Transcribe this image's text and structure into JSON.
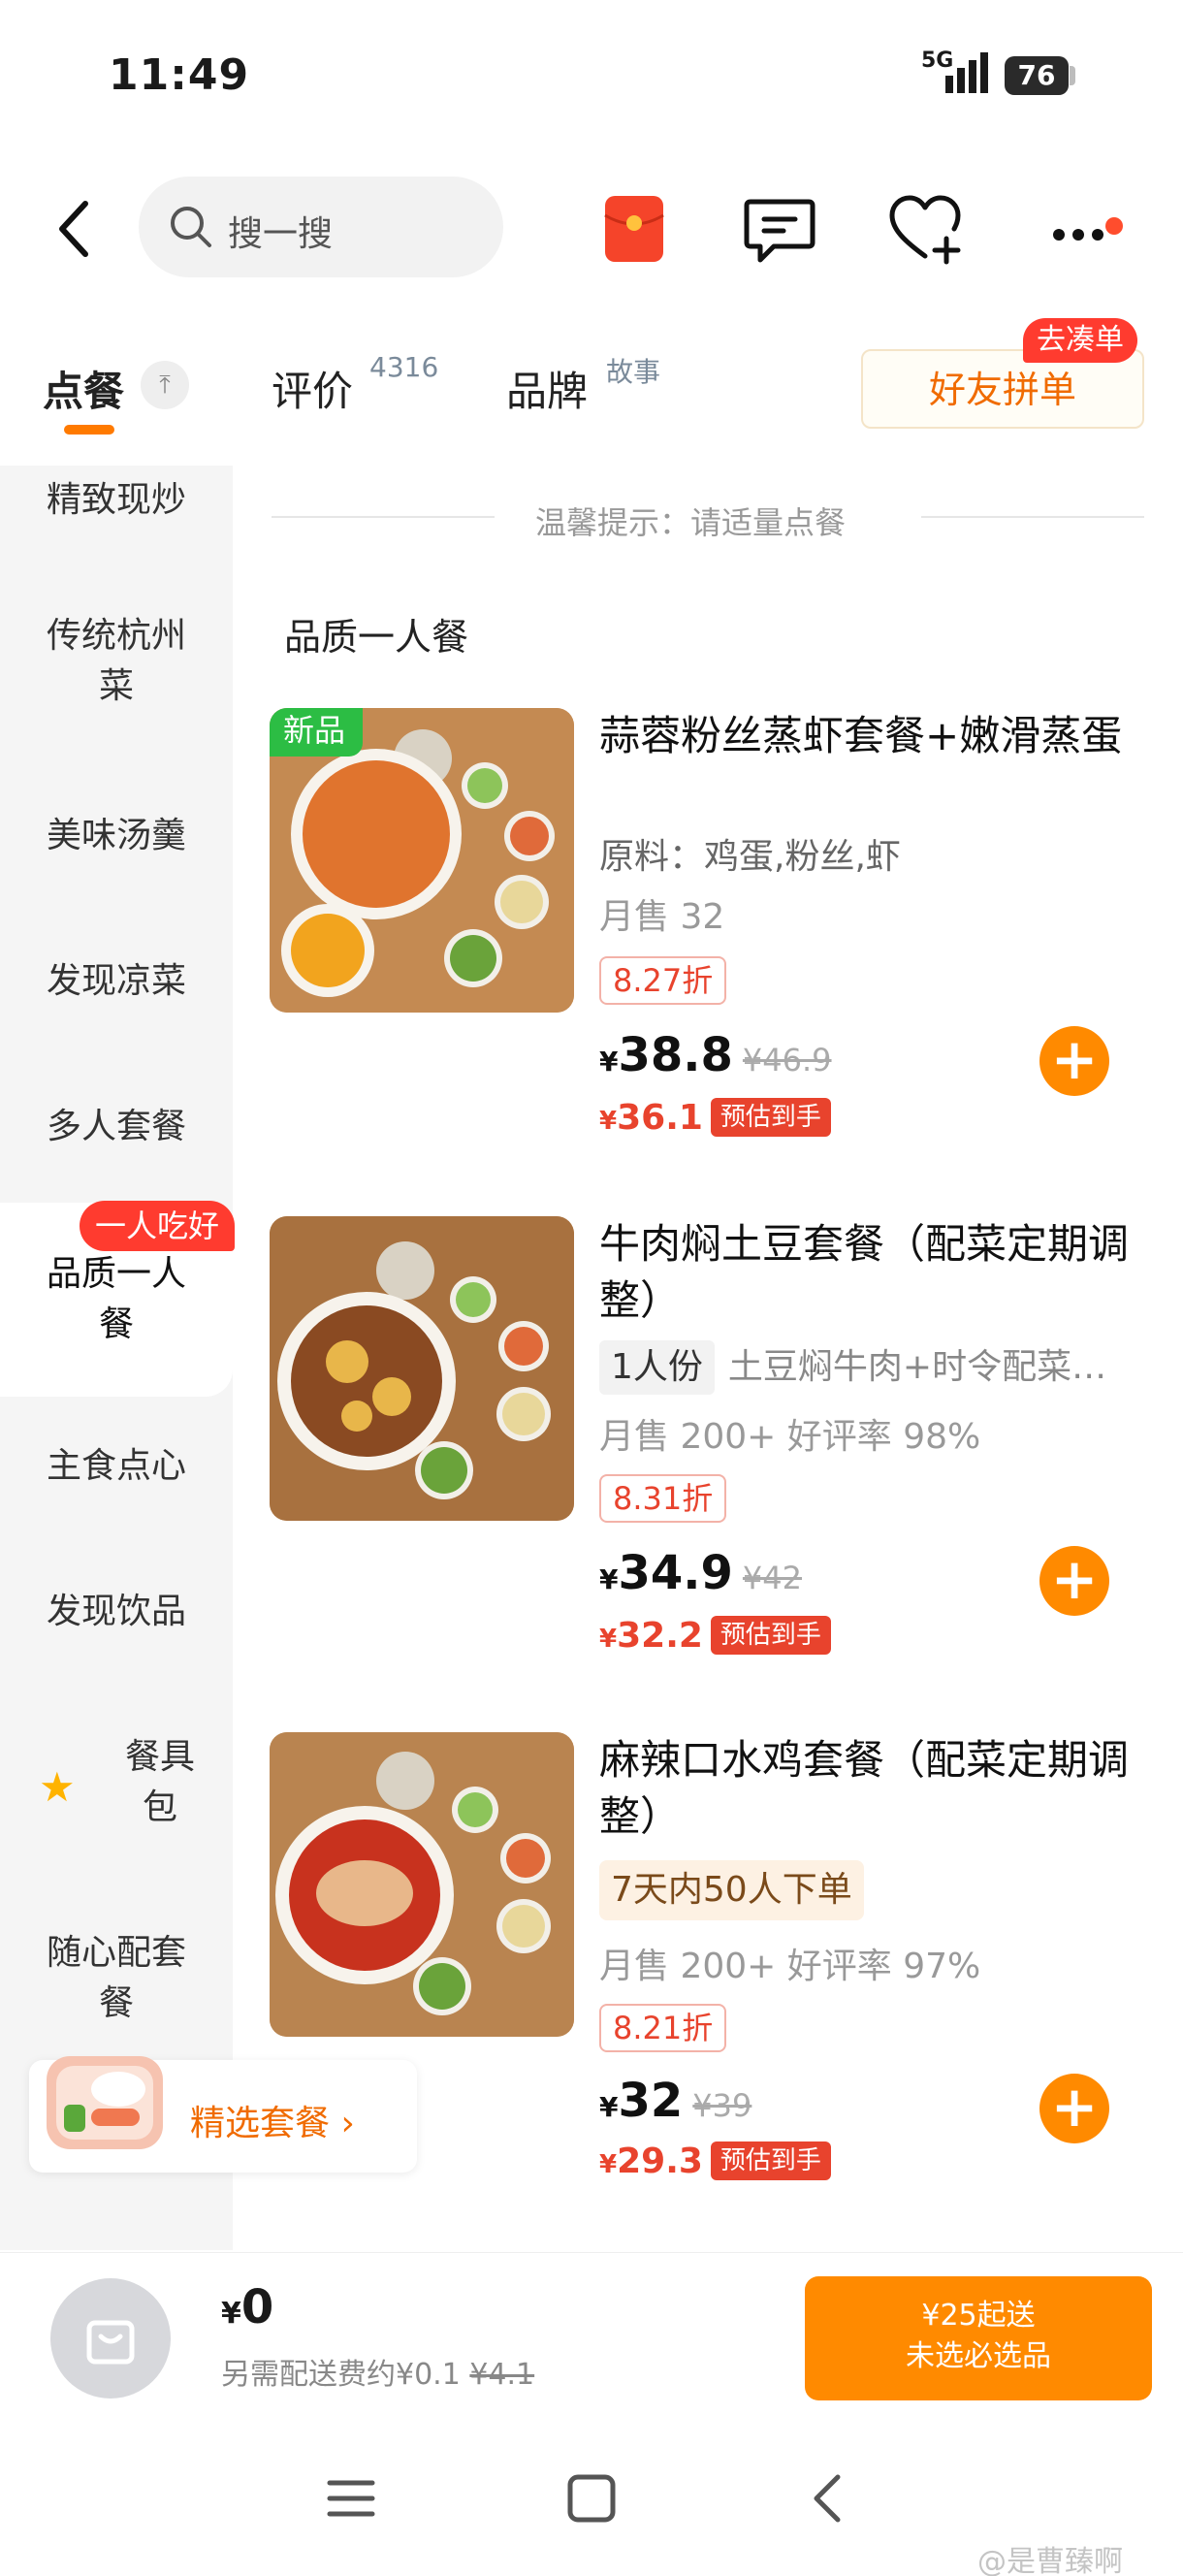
{
  "status_bar": {
    "time": "11:49",
    "network": "5G",
    "battery": "76"
  },
  "header": {
    "search_placeholder": "搜一搜"
  },
  "tabs": {
    "order": "点餐",
    "pin": "⤒",
    "review": "评价",
    "review_count": "4316",
    "brand": "品牌",
    "brand_sup": "故事",
    "group_order": "好友拼单",
    "group_badge": "去凑单"
  },
  "sidebar": {
    "items": [
      "精致现炒",
      "传统杭州菜",
      "美味汤羹",
      "发现凉菜",
      "多人套餐",
      "品质一人餐",
      "主食点心",
      "发现饮品",
      "餐具包",
      "随心配套餐"
    ],
    "active_badge": "一人吃好"
  },
  "main": {
    "tip": "温馨提示：请适量点餐",
    "section_title": "品质一人餐",
    "items": [
      {
        "badge": "新品",
        "title": "蒜蓉粉丝蒸虾套餐+嫩滑蒸蛋",
        "ingredients": "原料：鸡蛋,粉丝,虾",
        "sales": "月售 32",
        "discount": "8.27折",
        "currency": "¥",
        "price": "38.8",
        "original_price": "¥46.9",
        "est_price": "36.1",
        "est_tag": "预估到手",
        "add": "+"
      },
      {
        "title": "牛肉焖土豆套餐（配菜定期调整）",
        "portion": "1人份",
        "description": "土豆焖牛肉+时令配菜…",
        "sales": "月售 200+ 好评率 98%",
        "discount": "8.31折",
        "currency": "¥",
        "price": "34.9",
        "original_price": "¥42",
        "est_price": "32.2",
        "est_tag": "预估到手",
        "add": "+"
      },
      {
        "title": "麻辣口水鸡套餐（配菜定期调整）",
        "hot_label": "7天内50人下单",
        "sales": "月售 200+ 好评率 97%",
        "discount": "8.21折",
        "currency": "¥",
        "price": "32",
        "original_price": "¥39",
        "est_price": "29.3",
        "est_tag": "预估到手",
        "add": "+"
      }
    ]
  },
  "promo": {
    "label": "精选套餐 ›"
  },
  "cart": {
    "currency": "¥",
    "total": "0",
    "delivery_label": "另需配送费约¥0.1",
    "delivery_original": "¥4.1",
    "checkout_line1": "¥25起送",
    "checkout_line2": "未选必选品"
  },
  "watermark": "@是曹臻啊",
  "colors": {
    "accent": "#ff8a00",
    "red": "#e8432d",
    "new_green": "#2cbd44"
  }
}
